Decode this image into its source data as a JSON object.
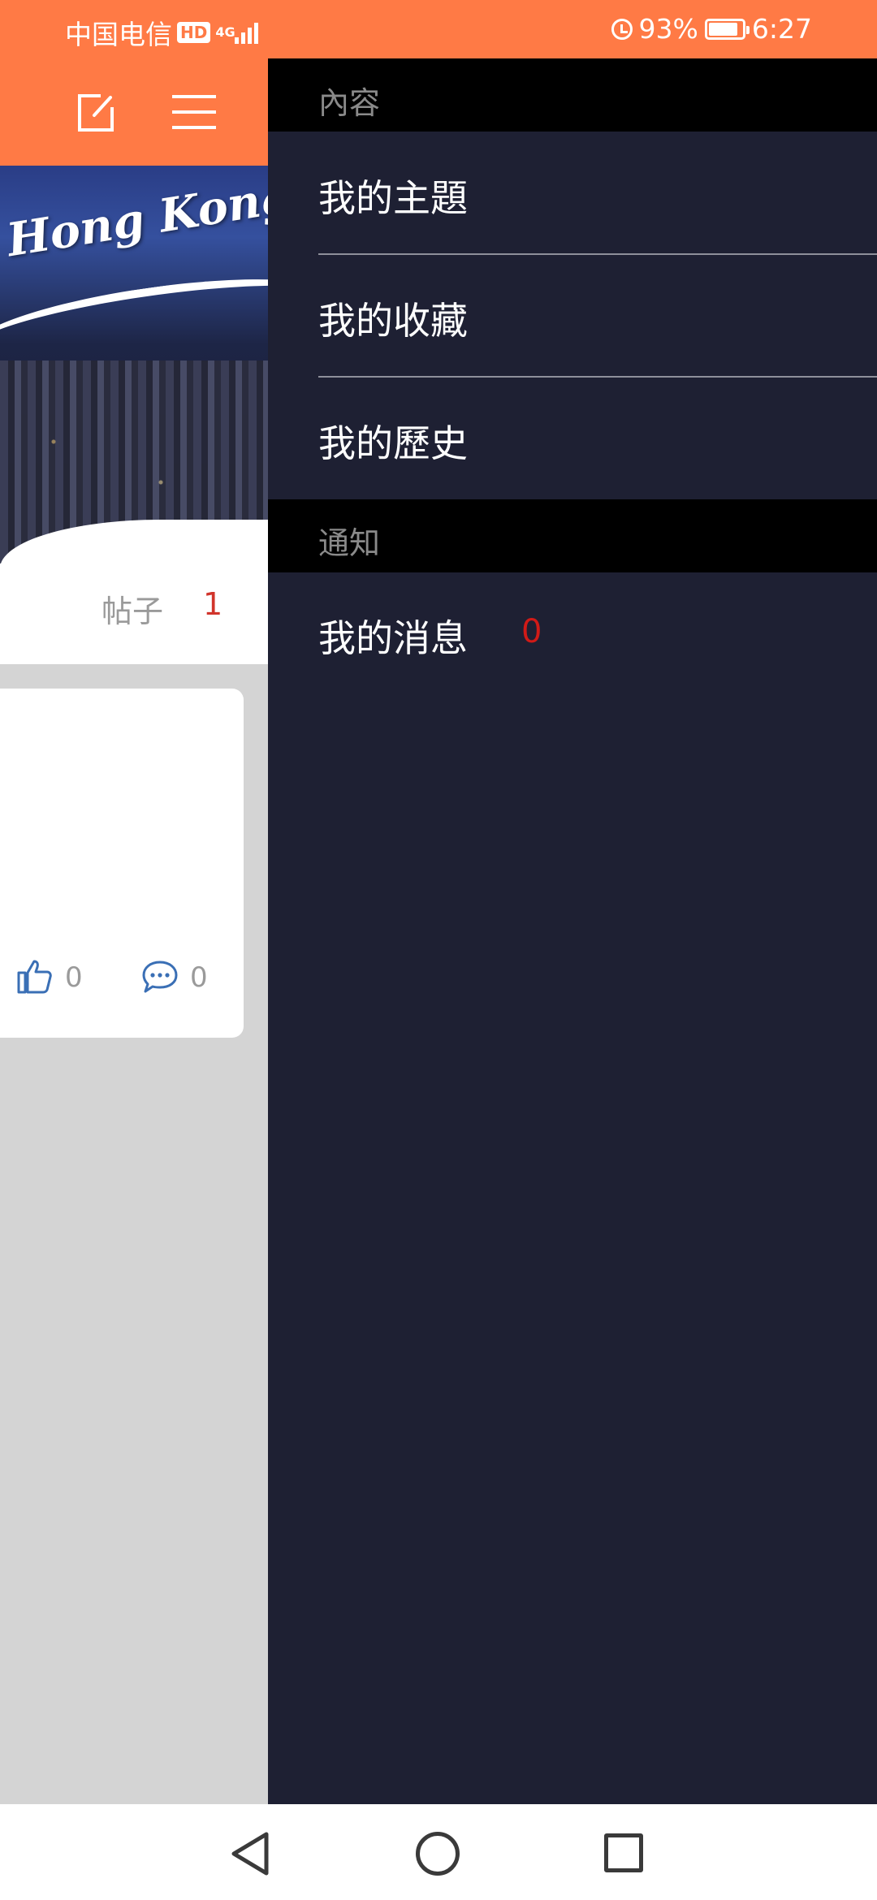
{
  "status_bar": {
    "carrier": "中国电信",
    "hd": "HD",
    "network": "4G",
    "battery": "93%",
    "time": "6:27"
  },
  "banner": {
    "text": "Hong Kong"
  },
  "stats": {
    "posts_label": "帖子",
    "posts_count": "1"
  },
  "post_card": {
    "likes": "0",
    "comments": "0"
  },
  "drawer": {
    "sections": [
      {
        "title": "內容",
        "items": [
          "我的主題",
          "我的收藏",
          "我的歷史"
        ]
      },
      {
        "title": "通知",
        "items": [
          "我的消息"
        ]
      }
    ],
    "message_count": "0"
  },
  "colors": {
    "accent": "#ff7a45",
    "drawer_bg": "#1e2033",
    "section_bg": "#000000",
    "count_red": "#d11a17"
  },
  "icons": {
    "header": [
      "compose-icon",
      "menu-icon"
    ],
    "nav": [
      "back-icon",
      "home-icon",
      "recents-icon"
    ]
  }
}
